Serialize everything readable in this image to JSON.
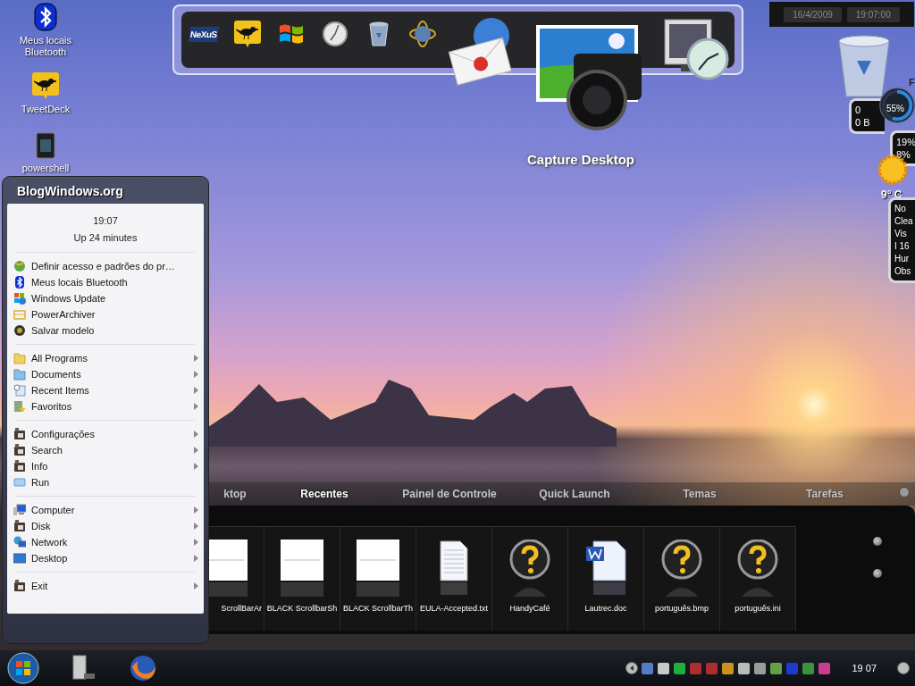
{
  "desktop_icons": [
    {
      "label": "Meus locais Bluetooth",
      "kind": "bluetooth"
    },
    {
      "label": "TweetDeck",
      "kind": "bird"
    },
    {
      "label": "powershell",
      "kind": "book"
    }
  ],
  "dock": {
    "items": [
      {
        "kind": "logo",
        "text": "NeXuS"
      },
      {
        "kind": "bird"
      },
      {
        "kind": "windows"
      },
      {
        "kind": "clock"
      },
      {
        "kind": "trash"
      },
      {
        "kind": "globe"
      }
    ],
    "large_items": [
      {
        "kind": "mail"
      },
      {
        "kind": "camera"
      },
      {
        "kind": "monitor"
      }
    ],
    "caption": "Capture Desktop"
  },
  "clock_gadget": {
    "date": "16/4/2009",
    "time": "19:07:00"
  },
  "right_gadgets": {
    "drive_title": "F",
    "drive_lines": [
      "0",
      "0 B"
    ],
    "meter": {
      "reading": "55%",
      "level": 0.55
    },
    "cpu_lines": [
      "19%",
      "8%"
    ],
    "temperature": "9° C",
    "weather_lines": [
      "No",
      "Clea",
      "Vis",
      "I 16",
      "Hur",
      "Obs"
    ]
  },
  "start_menu": {
    "title": "BlogWindows.org",
    "time": "19:07",
    "uptime": "Up 24 minutes",
    "groups": [
      [
        {
          "label": "Definir acesso e padrões do pr…",
          "kind": "globe",
          "submenu": false
        },
        {
          "label": "Meus locais Bluetooth",
          "kind": "bluetooth",
          "submenu": false
        },
        {
          "label": "Windows Update",
          "kind": "flag",
          "submenu": false
        },
        {
          "label": "PowerArchiver",
          "kind": "archive",
          "submenu": false
        },
        {
          "label": "Salvar modelo",
          "kind": "orb",
          "submenu": false
        }
      ],
      [
        {
          "label": "All Programs",
          "kind": "folder",
          "submenu": true
        },
        {
          "label": "Documents",
          "kind": "documents",
          "submenu": true
        },
        {
          "label": "Recent Items",
          "kind": "recent",
          "submenu": true
        },
        {
          "label": "Favoritos",
          "kind": "star",
          "submenu": true
        }
      ],
      [
        {
          "label": "Configurações",
          "kind": "app",
          "submenu": true
        },
        {
          "label": "Search",
          "kind": "app",
          "submenu": true
        },
        {
          "label": "Info",
          "kind": "app",
          "submenu": true
        },
        {
          "label": "Run",
          "kind": "run",
          "submenu": false
        }
      ],
      [
        {
          "label": "Computer",
          "kind": "computer",
          "submenu": true
        },
        {
          "label": "Disk",
          "kind": "app",
          "submenu": true
        },
        {
          "label": "Network",
          "kind": "network",
          "submenu": true
        },
        {
          "label": "Desktop",
          "kind": "desktop",
          "submenu": true
        }
      ],
      [
        {
          "label": "Exit",
          "kind": "app",
          "submenu": true
        }
      ]
    ]
  },
  "panel": {
    "tabs": [
      {
        "label": "ktop",
        "selected": false
      },
      {
        "label": "Recentes",
        "selected": true
      },
      {
        "label": "Painel de Controle",
        "selected": false
      },
      {
        "label": "Quick Launch",
        "selected": false
      },
      {
        "label": "Temas",
        "selected": false
      },
      {
        "label": "Tarefas",
        "selected": false
      }
    ],
    "files": [
      {
        "name": "ScrollBarAr",
        "kind": "image"
      },
      {
        "name": "BLACK ScrollbarSh",
        "kind": "image"
      },
      {
        "name": "BLACK ScrollbarTh",
        "kind": "image"
      },
      {
        "name": "EULA-Accepted.txt",
        "kind": "text"
      },
      {
        "name": "HandyCafé",
        "kind": "unknown"
      },
      {
        "name": "Lautrec.doc",
        "kind": "word"
      },
      {
        "name": "português.bmp",
        "kind": "unknown"
      },
      {
        "name": "português.ini",
        "kind": "unknown"
      }
    ]
  },
  "taskbar": {
    "clock": "19 07"
  }
}
